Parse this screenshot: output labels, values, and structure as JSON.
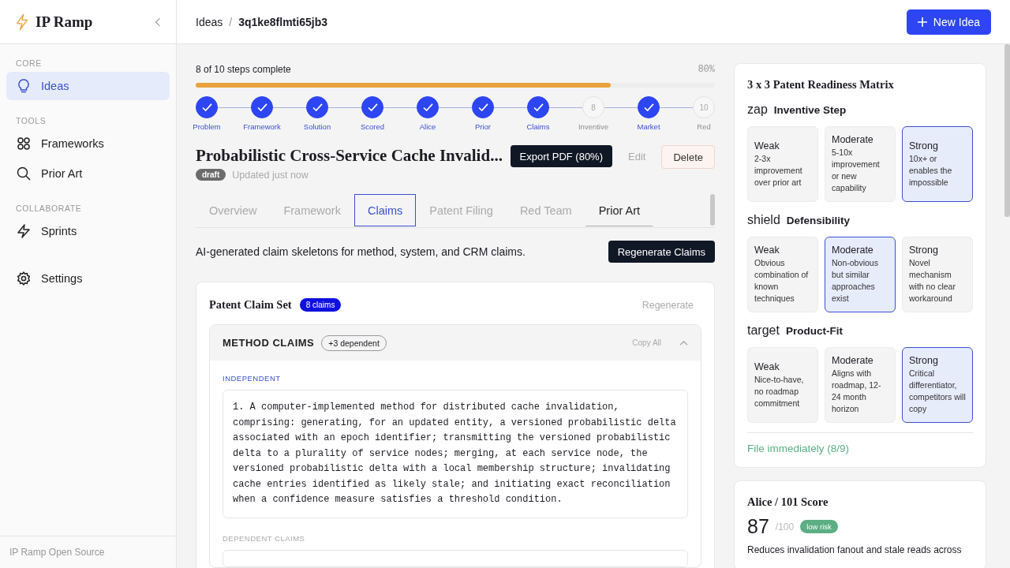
{
  "brand": {
    "name": "IP Ramp"
  },
  "sidebar": {
    "sections": [
      {
        "title": "CORE",
        "items": [
          {
            "label": "Ideas",
            "kind": "bulb",
            "selected": true
          }
        ]
      },
      {
        "title": "TOOLS",
        "items": [
          {
            "label": "Frameworks",
            "kind": "grid",
            "selected": false
          },
          {
            "label": "Prior Art",
            "kind": "search",
            "selected": false
          }
        ]
      },
      {
        "title": "COLLABORATE",
        "items": [
          {
            "label": "Sprints",
            "kind": "zap",
            "selected": false
          }
        ]
      },
      {
        "items": [
          {
            "label": "Settings",
            "kind": "gear",
            "selected": false
          }
        ]
      }
    ],
    "footer": "IP Ramp Open Source"
  },
  "breadcrumb": {
    "parent": "Ideas",
    "separator": "/",
    "current": "3q1ke8flmti65jb3"
  },
  "new_button": "New Idea",
  "progress": {
    "label": "8 of 10 steps complete",
    "percent": "80%",
    "level": 0.8
  },
  "steps": [
    {
      "label": "Problem",
      "done": true
    },
    {
      "label": "Framework",
      "done": true
    },
    {
      "label": "Solution",
      "done": true
    },
    {
      "label": "Scored",
      "done": true
    },
    {
      "label": "Alice",
      "done": true
    },
    {
      "label": "Prior",
      "done": true
    },
    {
      "label": "Claims",
      "done": true
    },
    {
      "label": "Inventive",
      "done": false,
      "number": "8"
    },
    {
      "label": "Market",
      "done": true
    },
    {
      "label": "Red",
      "done": false,
      "number": "10"
    }
  ],
  "idea": {
    "title": "Probabilistic Cross-Service Cache Invalid...",
    "status": "draft",
    "updated": "Updated just now"
  },
  "actions": {
    "export": "Export PDF (80%)",
    "edit": "Edit",
    "delete": "Delete"
  },
  "tabs": [
    {
      "label": "Overview",
      "selected": false,
      "hovered": false
    },
    {
      "label": "Framework",
      "selected": false,
      "hovered": false
    },
    {
      "label": "Claims",
      "selected": true,
      "hovered": false
    },
    {
      "label": "Patent Filing",
      "selected": false,
      "hovered": false
    },
    {
      "label": "Red Team",
      "selected": false,
      "hovered": false
    },
    {
      "label": "Prior Art",
      "selected": false,
      "hovered": true
    }
  ],
  "claims": {
    "intro": "AI-generated claim skeletons for method, system, and CRM claims.",
    "regenerate_button": "Regenerate Claims",
    "card": {
      "title": "Patent Claim Set",
      "count": "8 claims",
      "regenerate": "Regenerate",
      "group": {
        "title": "METHOD CLAIMS",
        "dependent": "+3 dependent",
        "copy": "Copy All",
        "expanded": true,
        "independent_label": "INDEPENDENT",
        "independent_text": "1. A computer-implemented method for distributed cache invalidation, comprising: generating, for an updated entity, a versioned probabilistic delta associated with an epoch identifier; transmitting the versioned probabilistic delta to a plurality of service nodes; merging, at each service node, the versioned probabilistic delta with a local membership structure; invalidating cache entries identified as likely stale; and initiating exact reconciliation when a confidence measure satisfies a threshold condition.",
        "dependent_label": "DEPENDENT CLAIMS"
      }
    }
  },
  "matrix": {
    "title": "3 x 3 Patent Readiness Matrix",
    "criteria": [
      {
        "icon_label": "zap",
        "name": "Inventive Step",
        "levels": [
          {
            "name": "Weak",
            "desc": "2-3x improvement over prior art",
            "selected": false
          },
          {
            "name": "Moderate",
            "desc": "5-10x improvement or new capability",
            "selected": false
          },
          {
            "name": "Strong",
            "desc": "10x+ or enables the impossible",
            "selected": true
          }
        ]
      },
      {
        "icon_label": "shield",
        "name": "Defensibility",
        "levels": [
          {
            "name": "Weak",
            "desc": "Obvious combination of known techniques",
            "selected": false
          },
          {
            "name": "Moderate",
            "desc": "Non-obvious but similar approaches exist",
            "selected": true
          },
          {
            "name": "Strong",
            "desc": "Novel mechanism with no clear workaround",
            "selected": false
          }
        ]
      },
      {
        "icon_label": "target",
        "name": "Product-Fit",
        "levels": [
          {
            "name": "Weak",
            "desc": "Nice-to-have, no roadmap commitment",
            "selected": false
          },
          {
            "name": "Moderate",
            "desc": "Aligns with roadmap, 12-24 month horizon",
            "selected": false
          },
          {
            "name": "Strong",
            "desc": "Critical differentiator, competitors will copy",
            "selected": true
          }
        ]
      }
    ],
    "verdict": "File immediately (8/9)"
  },
  "alice": {
    "title": "Alice / 101 Score",
    "score": "87",
    "max": "/100",
    "risk": "low risk",
    "summary": "Reduces invalidation fanout and stale reads across"
  }
}
